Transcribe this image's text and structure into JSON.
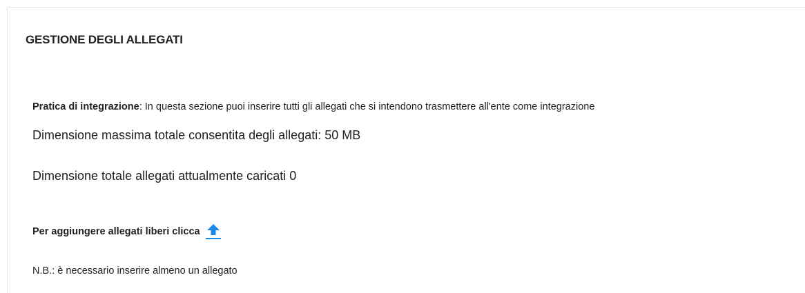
{
  "section": {
    "title": "GESTIONE DEGLI ALLEGATI"
  },
  "intro": {
    "label": "Pratica di integrazione",
    "text": ": In questa sezione puoi inserire tutti gli allegati che si intendono trasmettere all'ente come integrazione"
  },
  "limits": {
    "max_total": "Dimensione massima totale consentita degli allegati:  50 MB",
    "current_total": "Dimensione totale allegati attualmente caricati 0"
  },
  "add": {
    "label": "Per aggiungere allegati liberi clicca",
    "icon": "upload-icon",
    "icon_color": "#1e88e5"
  },
  "note": {
    "text": "N.B.: è necessario inserire almeno un allegato"
  }
}
